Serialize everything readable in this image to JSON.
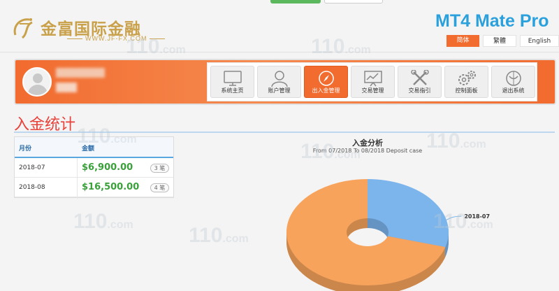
{
  "header": {
    "logo_cn": "金富国际金融",
    "logo_url": "WWW.JF-FX.COM",
    "app_title": "MT4 Mate Pro",
    "languages": [
      {
        "label": "简体",
        "active": true
      },
      {
        "label": "繁體",
        "active": false
      },
      {
        "label": "English",
        "active": false
      }
    ]
  },
  "nav": {
    "items": [
      {
        "label": "系统主页",
        "icon": "monitor-icon",
        "active": false
      },
      {
        "label": "账户管理",
        "icon": "user-icon",
        "active": false
      },
      {
        "label": "出入金管理",
        "icon": "compass-icon",
        "active": true
      },
      {
        "label": "交易管理",
        "icon": "chart-icon",
        "active": false
      },
      {
        "label": "交易指引",
        "icon": "tools-icon",
        "active": false
      },
      {
        "label": "控制面板",
        "icon": "gears-icon",
        "active": false
      },
      {
        "label": "退出系统",
        "icon": "logout-icon",
        "active": false
      }
    ]
  },
  "page": {
    "title": "入金统计"
  },
  "table": {
    "headers": [
      "月份",
      "金额"
    ],
    "rows": [
      {
        "month": "2018-07",
        "amount": "$6,900.00",
        "count": "3 笔"
      },
      {
        "month": "2018-08",
        "amount": "$16,500.00",
        "count": "4 笔"
      }
    ]
  },
  "chart_data": {
    "type": "pie",
    "title": "入金分析",
    "subtitle": "From 07/2018 To 08/2018 Deposit case",
    "categories": [
      "2018-07",
      "2018-08"
    ],
    "values": [
      6900,
      16500
    ],
    "colors": [
      "#7cb5ec",
      "#f7a35c"
    ],
    "donut": true,
    "visible_labels": [
      "2018-07"
    ]
  },
  "watermark": {
    "text": "110",
    "suffix": ".com"
  },
  "colors": {
    "accent": "#f26b2f",
    "title_red": "#e8413a",
    "brand_blue": "#2aa0dc",
    "gold": "#c9a14a",
    "amount_green": "#3aa13a"
  }
}
